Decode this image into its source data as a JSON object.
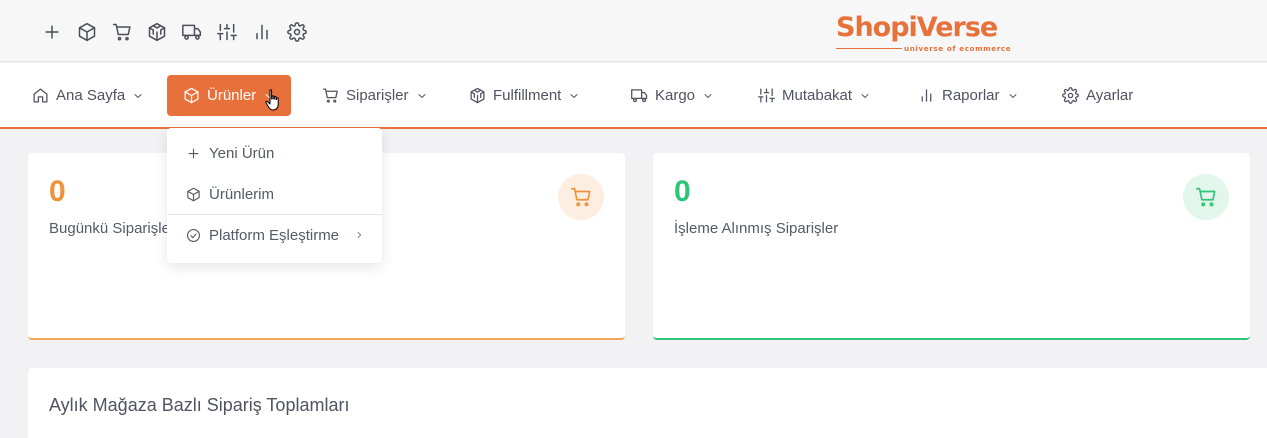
{
  "app": {
    "logo_text": "ShopiVerse",
    "logo_tagline": "universe of ecommerce",
    "brand_color": "#e8703a"
  },
  "quick_icons": [
    "plus-icon",
    "box-icon",
    "cart-icon",
    "codesandbox-icon",
    "truck-icon",
    "sliders-icon",
    "bar-chart-icon",
    "gear-icon"
  ],
  "nav": {
    "items": [
      {
        "label": "Ana Sayfa",
        "icon": "home-icon"
      },
      {
        "label": "Ürünler",
        "icon": "box-icon",
        "active": true
      },
      {
        "label": "Siparişler",
        "icon": "cart-icon"
      },
      {
        "label": "Fulfillment",
        "icon": "codesandbox-icon"
      },
      {
        "label": "Kargo",
        "icon": "truck-icon"
      },
      {
        "label": "Mutabakat",
        "icon": "sliders-icon"
      },
      {
        "label": "Raporlar",
        "icon": "bar-chart-icon"
      },
      {
        "label": "Ayarlar",
        "icon": "gear-icon"
      }
    ]
  },
  "dropdown": {
    "items": [
      {
        "label": "Yeni Ürün",
        "icon": "plus-icon"
      },
      {
        "label": "Ürünlerim",
        "icon": "box-icon"
      },
      {
        "label": "Platform Eşleştirme",
        "icon": "check-circle-icon",
        "has_submenu": true
      }
    ]
  },
  "cards": [
    {
      "value": "0",
      "label": "Bugünkü Siparişler",
      "accent": "#f0923a",
      "icon": "cart-icon"
    },
    {
      "value": "0",
      "label": "İşleme Alınmış Siparişler",
      "accent": "#2ec479",
      "icon": "cart-icon"
    }
  ],
  "section": {
    "title": "Aylık Mağaza Bazlı Sipariş Toplamları"
  }
}
